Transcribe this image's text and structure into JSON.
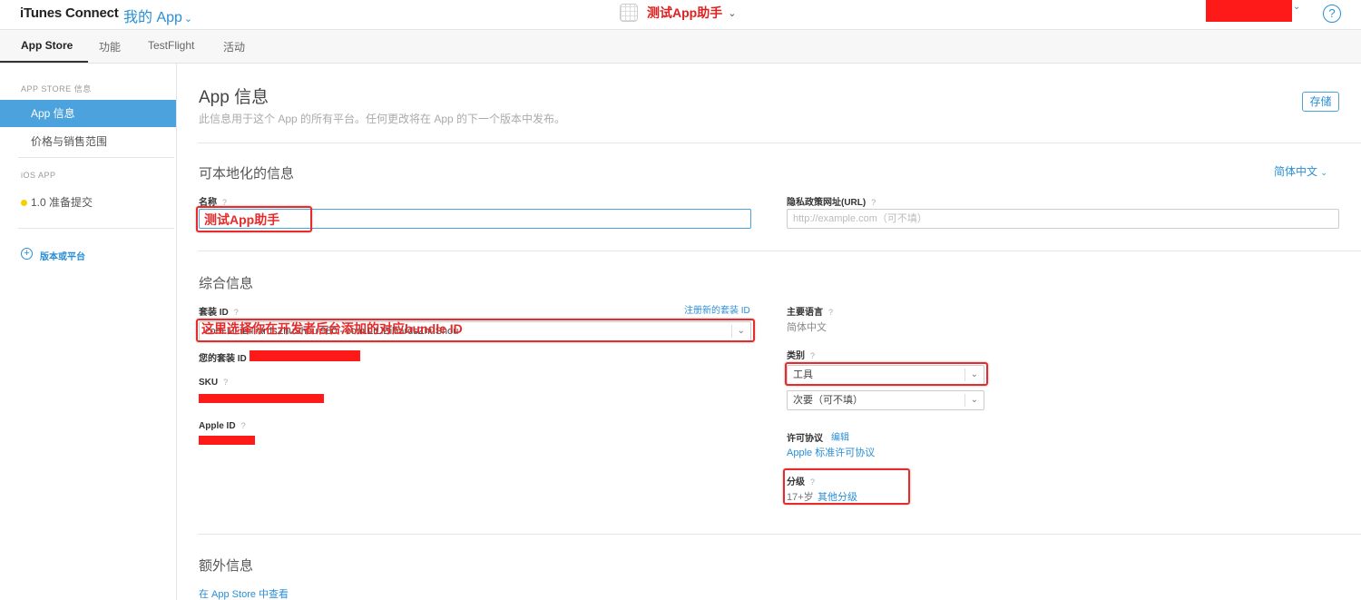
{
  "topbar": {
    "brand": "iTunes Connect",
    "my_apps": "我的 App",
    "app_name": "测试App助手"
  },
  "tabs": [
    "App Store",
    "功能",
    "TestFlight",
    "活动"
  ],
  "sidebar": {
    "section_store": "APP STORE 信息",
    "items": [
      "App 信息",
      "价格与销售范围"
    ],
    "section_ios": "iOS APP",
    "version_item": "1.0 准备提交",
    "add_label": "版本或平台"
  },
  "page": {
    "title": "App 信息",
    "subtitle": "此信息用于这个 App 的所有平台。任何更改将在 App 的下一个版本中发布。",
    "save": "存储"
  },
  "localizable": {
    "title": "可本地化的信息",
    "language": "简体中文",
    "name_label": "名称",
    "name_annotation": "测试App助手",
    "privacy_label": "隐私政策网址(URL)",
    "privacy_placeholder": "http://example.com（可不填）"
  },
  "general": {
    "title": "综合信息",
    "bundle_label": "套装 ID",
    "register_bundle": "注册新的套装 ID",
    "bundle_value": "com.LiLiBilliardsZhuShou 980 - com.LiLiBilliardsZhuShou",
    "bundle_annotation": "这里选择你在开发者后台添加的对应bundle ID",
    "your_bundle_label": "您的套装 ID",
    "sku_label": "SKU",
    "apple_id_label": "Apple ID",
    "primary_language_label": "主要语言",
    "primary_language_value": "简体中文",
    "category_label": "类别",
    "category_primary": "工具",
    "category_secondary": "次要（可不填）",
    "license_label": "许可协议",
    "license_edit": "编辑",
    "license_value": "Apple 标准许可协议",
    "rating_label": "分级",
    "rating_value": "17+岁",
    "rating_other": "其他分级"
  },
  "extra": {
    "title": "额外信息",
    "view_in_store": "在 App Store 中查看"
  },
  "colors": {
    "accent": "#2a8fd6",
    "annotation": "#e82a2a",
    "sidebar_active": "#4ba2dd"
  }
}
